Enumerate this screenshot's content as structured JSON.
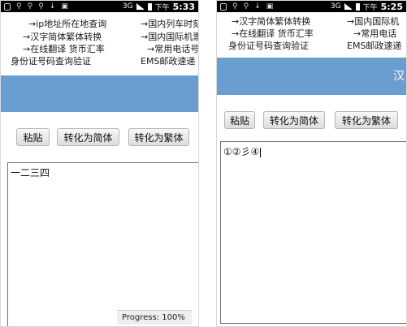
{
  "left": {
    "status": {
      "network": "3G",
      "ampm": "下午",
      "time": "5:33"
    },
    "links": [
      "→ip地址所在地查询",
      "→国内列车时刻",
      "→汉字简体繁体转换",
      "→国内国际机票",
      "→在线翻译 货币汇率",
      "→常用电话号",
      "身份证号码查询验证",
      "EMS邮政速递"
    ],
    "buttons": {
      "paste": "粘贴",
      "to_simplified": "转化为简体",
      "to_traditional": "转化为繁体"
    },
    "textarea_value": "一二三四",
    "progress": "Progress: 100%"
  },
  "right": {
    "status": {
      "network": "3G",
      "ampm": "下午",
      "time": "5:25"
    },
    "links": [
      "→汉字简体繁体转换",
      "→国内国际机",
      "→在线翻译 货币汇率",
      "→常用电话",
      "身份证号码查询验证",
      "EMS邮政速递"
    ],
    "title_partial": "汉",
    "buttons": {
      "paste": "粘贴",
      "to_simplified": "转化为简体",
      "to_traditional": "转化为繁体"
    },
    "textarea_value": "①②彡④"
  }
}
